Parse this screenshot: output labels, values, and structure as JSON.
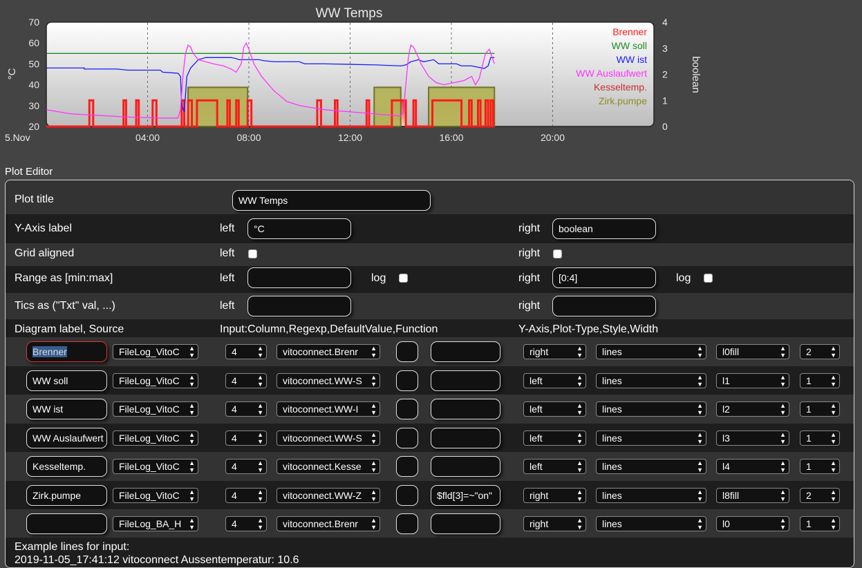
{
  "chart_data": {
    "type": "line",
    "title": "WW Temps",
    "ylabel": "°C",
    "y2label": "boolean",
    "ylim": [
      20,
      70
    ],
    "y2lim": [
      0,
      4
    ],
    "yticks": [
      "70",
      "60",
      "50",
      "40",
      "30",
      "20"
    ],
    "y2ticks": [
      "4",
      "3",
      "2",
      "1",
      "0"
    ],
    "xlim": [
      0,
      24
    ],
    "xticks": [
      {
        "h": 0,
        "label": "5.Nov"
      },
      {
        "h": 4,
        "label": "04:00"
      },
      {
        "h": 8,
        "label": "08:00"
      },
      {
        "h": 12,
        "label": "12:00"
      },
      {
        "h": 16,
        "label": "16:00"
      },
      {
        "h": 20,
        "label": "20:00"
      }
    ],
    "grid": "x",
    "legend": "top-right",
    "series": [
      {
        "name": "Brenner",
        "axis": "right",
        "color": "#ff1a1a",
        "steps": [
          [
            0,
            0
          ],
          [
            1.7,
            0
          ],
          [
            1.7,
            1
          ],
          [
            1.85,
            1
          ],
          [
            1.85,
            0
          ],
          [
            3.05,
            0
          ],
          [
            3.05,
            1
          ],
          [
            3.15,
            1
          ],
          [
            3.15,
            0
          ],
          [
            3.55,
            0
          ],
          [
            3.55,
            1
          ],
          [
            3.65,
            1
          ],
          [
            3.65,
            0
          ],
          [
            4.2,
            0
          ],
          [
            4.2,
            1
          ],
          [
            4.35,
            1
          ],
          [
            4.35,
            0
          ],
          [
            5.35,
            0
          ],
          [
            5.35,
            1
          ],
          [
            5.45,
            1
          ],
          [
            5.45,
            0
          ],
          [
            5.6,
            0
          ],
          [
            5.6,
            1
          ],
          [
            5.75,
            1
          ],
          [
            5.75,
            0
          ],
          [
            5.95,
            0
          ],
          [
            5.95,
            1
          ],
          [
            6.75,
            1
          ],
          [
            6.75,
            0
          ],
          [
            7.15,
            0
          ],
          [
            7.15,
            1
          ],
          [
            7.25,
            1
          ],
          [
            7.25,
            0
          ],
          [
            7.5,
            0
          ],
          [
            7.5,
            1
          ],
          [
            7.6,
            1
          ],
          [
            7.6,
            0
          ],
          [
            7.95,
            0
          ],
          [
            7.95,
            1
          ],
          [
            8.1,
            1
          ],
          [
            8.1,
            0
          ],
          [
            10.7,
            0
          ],
          [
            10.7,
            1
          ],
          [
            10.85,
            1
          ],
          [
            10.85,
            0
          ],
          [
            11.4,
            0
          ],
          [
            11.4,
            1
          ],
          [
            11.5,
            1
          ],
          [
            11.5,
            0
          ],
          [
            12.65,
            0
          ],
          [
            12.65,
            1
          ],
          [
            12.75,
            1
          ],
          [
            12.75,
            0
          ],
          [
            13.65,
            0
          ],
          [
            13.65,
            1
          ],
          [
            14.2,
            1
          ],
          [
            14.2,
            0
          ],
          [
            14.5,
            0
          ],
          [
            14.5,
            1
          ],
          [
            14.6,
            1
          ],
          [
            14.6,
            0
          ],
          [
            15.25,
            0
          ],
          [
            15.25,
            1
          ],
          [
            16.4,
            1
          ],
          [
            16.4,
            0
          ],
          [
            16.7,
            0
          ],
          [
            16.7,
            1
          ],
          [
            16.8,
            1
          ],
          [
            16.8,
            0
          ],
          [
            17.05,
            0
          ],
          [
            17.05,
            1
          ],
          [
            17.15,
            1
          ],
          [
            17.15,
            0
          ],
          [
            17.35,
            0
          ],
          [
            17.35,
            1
          ],
          [
            17.45,
            1
          ],
          [
            17.45,
            0
          ],
          [
            17.55,
            0
          ],
          [
            17.55,
            1
          ],
          [
            17.65,
            1
          ],
          [
            17.65,
            0
          ],
          [
            17.7,
            0
          ]
        ]
      },
      {
        "name": "WW soll",
        "axis": "left",
        "color": "#1e8c1e",
        "points": [
          [
            0,
            55
          ],
          [
            17.7,
            55
          ]
        ]
      },
      {
        "name": "WW ist",
        "axis": "left",
        "color": "#1a1aff",
        "points": [
          [
            0,
            48
          ],
          [
            1.5,
            48
          ],
          [
            1.5,
            47.5
          ],
          [
            2.8,
            47.5
          ],
          [
            3.2,
            47
          ],
          [
            4.5,
            47
          ],
          [
            4.6,
            46
          ],
          [
            5.2,
            45.5
          ],
          [
            5.3,
            44
          ],
          [
            5.35,
            30
          ],
          [
            5.45,
            27
          ],
          [
            5.55,
            44
          ],
          [
            5.7,
            48
          ],
          [
            6,
            52
          ],
          [
            6.3,
            53
          ],
          [
            7.3,
            53
          ],
          [
            7.5,
            52.5
          ],
          [
            7.6,
            52
          ],
          [
            8.4,
            52
          ],
          [
            8.6,
            51.5
          ],
          [
            9,
            51
          ],
          [
            10,
            51
          ],
          [
            10.2,
            50
          ],
          [
            11,
            50
          ],
          [
            13,
            49.5
          ],
          [
            14,
            49
          ],
          [
            14.2,
            49.5
          ],
          [
            14.4,
            51
          ],
          [
            14.7,
            52
          ],
          [
            14.9,
            51
          ],
          [
            15.3,
            52
          ],
          [
            15.5,
            50
          ],
          [
            16.2,
            50
          ],
          [
            16.4,
            49
          ],
          [
            16.8,
            49
          ],
          [
            17,
            48.5
          ],
          [
            17.3,
            47.8
          ],
          [
            17.45,
            49
          ],
          [
            17.55,
            53
          ],
          [
            17.7,
            53
          ]
        ]
      },
      {
        "name": "WW Auslaufwert",
        "axis": "left",
        "color": "#ff33ff",
        "points": [
          [
            0,
            28
          ],
          [
            0.5,
            27
          ],
          [
            1,
            26
          ],
          [
            2.5,
            25
          ],
          [
            3.2,
            24.5
          ],
          [
            4.5,
            24
          ],
          [
            5.2,
            24
          ],
          [
            5.3,
            28
          ],
          [
            5.4,
            45
          ],
          [
            5.5,
            55
          ],
          [
            5.6,
            59
          ],
          [
            5.7,
            58
          ],
          [
            5.8,
            55
          ],
          [
            6,
            52
          ],
          [
            6.3,
            51
          ],
          [
            6.6,
            50
          ],
          [
            7,
            49
          ],
          [
            7.3,
            47.5
          ],
          [
            7.5,
            46
          ],
          [
            7.7,
            50
          ],
          [
            7.8,
            58
          ],
          [
            7.9,
            60
          ],
          [
            8,
            57
          ],
          [
            8.2,
            50
          ],
          [
            8.5,
            44
          ],
          [
            9,
            37
          ],
          [
            9.5,
            32
          ],
          [
            10,
            30
          ],
          [
            11,
            28
          ],
          [
            12,
            27
          ],
          [
            13,
            26
          ],
          [
            14,
            25
          ],
          [
            14.1,
            27
          ],
          [
            14.2,
            40
          ],
          [
            14.3,
            53
          ],
          [
            14.4,
            59
          ],
          [
            14.5,
            58
          ],
          [
            14.7,
            53
          ],
          [
            14.8,
            50
          ],
          [
            14.9,
            48
          ],
          [
            15.1,
            44
          ],
          [
            15.4,
            41
          ],
          [
            15.7,
            40
          ],
          [
            16.1,
            41
          ],
          [
            16.5,
            42
          ],
          [
            16.8,
            44
          ],
          [
            16.95,
            40
          ],
          [
            17.1,
            43
          ],
          [
            17.35,
            55
          ],
          [
            17.5,
            57
          ],
          [
            17.7,
            50
          ]
        ]
      },
      {
        "name": "Kesseltemp.",
        "axis": "left",
        "color": "#c8322d",
        "fills": [
          [
            5.95,
            6.75
          ],
          [
            13.65,
            14.2
          ],
          [
            15.25,
            16.4
          ]
        ]
      },
      {
        "name": "Zirk.pumpe",
        "axis": "right",
        "color": "#8c8c28",
        "fills": [
          [
            5.6,
            7.95
          ],
          [
            12.95,
            14
          ],
          [
            15.1,
            17.7
          ]
        ]
      }
    ]
  },
  "editor": {
    "section_label": "Plot Editor",
    "plot_title": {
      "label": "Plot title",
      "value": "WW Temps"
    },
    "y_axis": {
      "label": "Y-Axis label",
      "left": "left",
      "left_value": "°C",
      "right": "right",
      "right_value": "boolean"
    },
    "grid": {
      "label": "Grid aligned",
      "left": "left",
      "right": "right"
    },
    "range": {
      "label": "Range as [min:max]",
      "left": "left",
      "left_value": "",
      "log_left": "log",
      "right": "right",
      "right_value": "[0:4]",
      "log_right": "log"
    },
    "tics": {
      "label": "Tics as (\"Txt\" val, ...)",
      "left": "left",
      "left_value": "",
      "right": "right",
      "right_value": ""
    },
    "headers": {
      "diagram": "Diagram label, Source",
      "input": "Input:Column,Regexp,DefaultValue,Function",
      "yaxis": "Y-Axis,Plot-Type,Style,Width"
    },
    "rows": [
      {
        "label": "Brenner",
        "source": "FileLog_VitoC",
        "column": "4",
        "regexp": "vitoconnect.Brenr",
        "default": "",
        "function": "",
        "axis": "right",
        "ptype": "lines",
        "style": "l0fill",
        "width": "2"
      },
      {
        "label": "WW soll",
        "source": "FileLog_VitoC",
        "column": "4",
        "regexp": "vitoconnect.WW-S",
        "default": "",
        "function": "",
        "axis": "left",
        "ptype": "lines",
        "style": "l1",
        "width": "1"
      },
      {
        "label": "WW ist",
        "source": "FileLog_VitoC",
        "column": "4",
        "regexp": "vitoconnect.WW-I",
        "default": "",
        "function": "",
        "axis": "left",
        "ptype": "lines",
        "style": "l2",
        "width": "1"
      },
      {
        "label": "WW Auslaufwert",
        "source": "FileLog_VitoC",
        "column": "4",
        "regexp": "vitoconnect.WW-S",
        "default": "",
        "function": "",
        "axis": "left",
        "ptype": "lines",
        "style": "l3",
        "width": "1"
      },
      {
        "label": "Kesseltemp.",
        "source": "FileLog_VitoC",
        "column": "4",
        "regexp": "vitoconnect.Kesse",
        "default": "",
        "function": "",
        "axis": "left",
        "ptype": "lines",
        "style": "l4",
        "width": "1"
      },
      {
        "label": "Zirk.pumpe",
        "source": "FileLog_VitoC",
        "column": "4",
        "regexp": "vitoconnect.WW-Z",
        "default": "",
        "function": "$fld[3]=~\"on\"",
        "axis": "right",
        "ptype": "lines",
        "style": "l8fill",
        "width": "2"
      },
      {
        "label": "",
        "source": "FileLog_BA_H",
        "column": "4",
        "regexp": "vitoconnect.Brenr",
        "default": "",
        "function": "",
        "axis": "right",
        "ptype": "lines",
        "style": "l0",
        "width": "1"
      }
    ],
    "example": {
      "label": "Example lines for input:",
      "line": "2019-11-05_17:41:12 vitoconnect Aussentemperatur: 10.6"
    }
  }
}
